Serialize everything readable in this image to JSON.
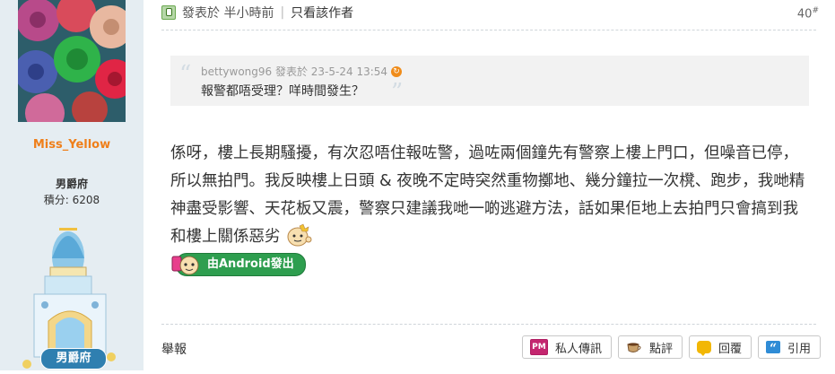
{
  "user": {
    "username": "Miss_Yellow",
    "rank": "男爵府",
    "points": "積分: 6208",
    "badge_label": "男爵府"
  },
  "post": {
    "posted_time": "發表於 半小時前",
    "author_only": "只看該作者",
    "floor": "40",
    "floor_mark": "#",
    "quote": {
      "author_line": "bettywong96 發表於 23-5-24 13:54",
      "text": "報警都唔受理？咩時間發生？"
    },
    "content": "係呀，樓上長期騷擾，有次忍唔住報咗警，過咗兩個鐘先有警察上樓上門口，但噪音已停，所以無拍門。我反映樓上日頭 & 夜晚不定時突然重物擲地、幾分鐘拉一次櫈、跑步，我哋精神盡受影響、天花板又震，警察只建議我哋一啲逃避方法，話如果佢地上去拍門只會搞到我和樓上關係惡劣",
    "android_badge": "由Android發出"
  },
  "footer": {
    "report": "舉報",
    "pm": "私人傳訊",
    "rate": "點評",
    "reply": "回覆",
    "quote": "引用"
  },
  "colors": {
    "username": "#ef7f1a",
    "sidebar_bg": "#e5edf2",
    "android_green": "#2e9e4f"
  },
  "icons": [
    "online-status-icon",
    "goto-post-icon",
    "emoji-icon",
    "android-icon",
    "pm-icon",
    "rate-icon",
    "reply-icon",
    "quote-icon"
  ]
}
